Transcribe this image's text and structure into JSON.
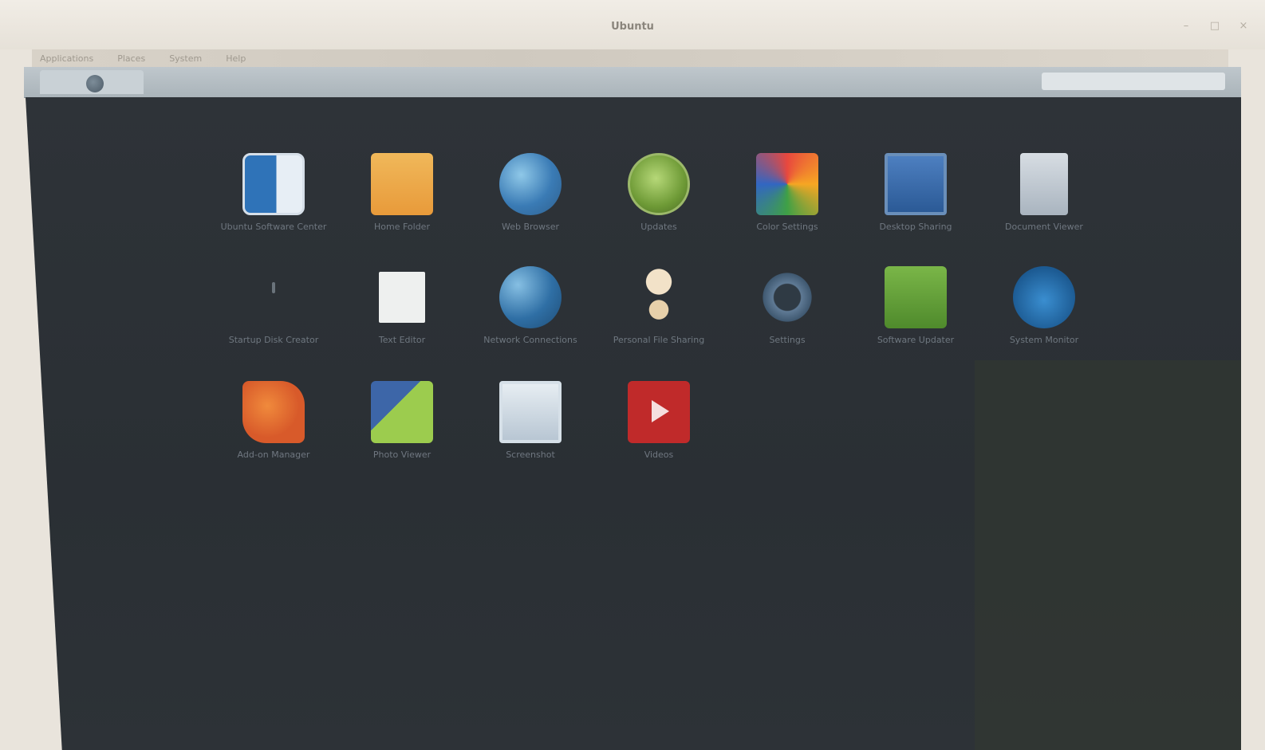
{
  "window": {
    "title": "Ubuntu"
  },
  "controls": {
    "minimize_icon": "minimize-icon",
    "maximize_icon": "maximize-icon",
    "close_icon": "close-icon"
  },
  "menubar": {
    "items": [
      "Applications",
      "Places",
      "System",
      "Help"
    ]
  },
  "desktop": {
    "apps": [
      {
        "label": "Ubuntu Software Center",
        "icon": "store-icon"
      },
      {
        "label": "Home Folder",
        "icon": "folder-icon"
      },
      {
        "label": "Web Browser",
        "icon": "globe-icon"
      },
      {
        "label": "Updates",
        "icon": "update-icon"
      },
      {
        "label": "Color Settings",
        "icon": "palette-icon"
      },
      {
        "label": "Desktop Sharing",
        "icon": "monitor-icon"
      },
      {
        "label": "Document Viewer",
        "icon": "document-icon"
      },
      {
        "label": "Startup Disk Creator",
        "icon": "bulb-icon"
      },
      {
        "label": "Text Editor",
        "icon": "paper-icon"
      },
      {
        "label": "Network Connections",
        "icon": "globe-check-icon"
      },
      {
        "label": "Personal File Sharing",
        "icon": "lighthouse-icon"
      },
      {
        "label": "Settings",
        "icon": "gear-icon"
      },
      {
        "label": "Software Updater",
        "icon": "green-box-icon"
      },
      {
        "label": "System Monitor",
        "icon": "blue-blob-icon"
      },
      {
        "label": "Add-on Manager",
        "icon": "puzzle-icon"
      },
      {
        "label": "Photo Viewer",
        "icon": "photos-icon"
      },
      {
        "label": "Screenshot",
        "icon": "picture-icon"
      },
      {
        "label": "Videos",
        "icon": "video-icon"
      }
    ]
  }
}
